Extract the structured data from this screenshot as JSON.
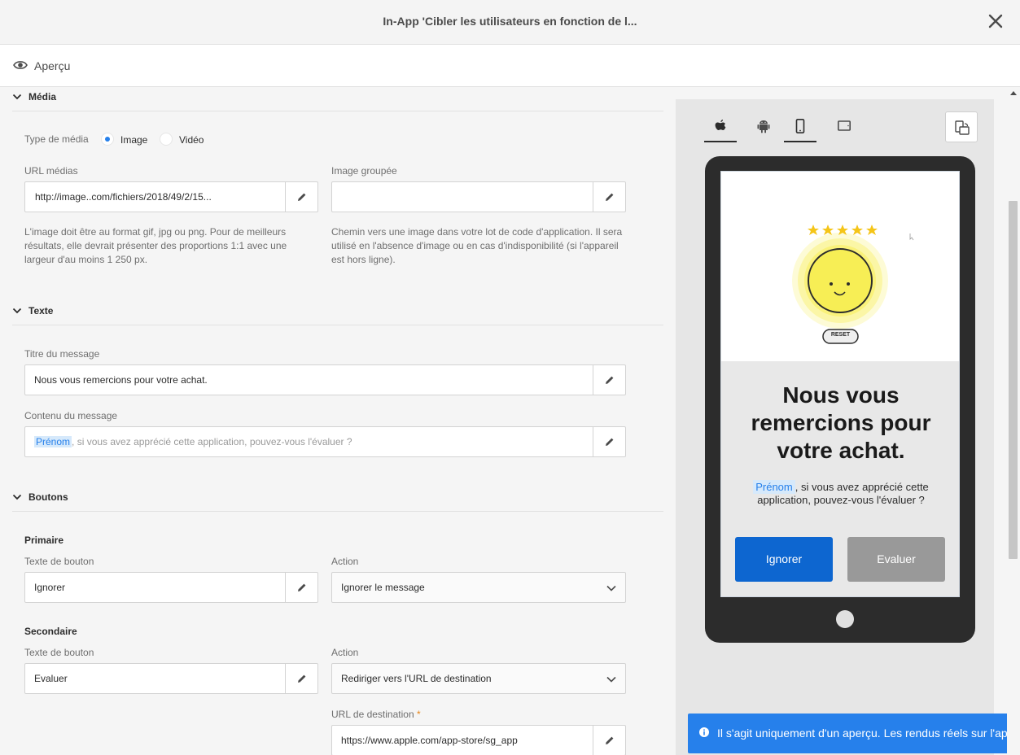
{
  "window": {
    "title": "In-App 'Cibler les utilisateurs en fonction de l...",
    "preview_label": "Aperçu"
  },
  "media": {
    "section_title": "Média",
    "type_label": "Type de média",
    "option_image": "Image",
    "option_video": "Vidéo",
    "selected": "Image",
    "url_label": "URL médias",
    "url_value": "http://image..com/fichiers/2018/49/2/15...",
    "url_help": "L'image doit être au format gif, jpg ou png. Pour de meilleurs résultats, elle devrait présenter des proportions 1:1 avec une largeur d'au moins 1 250 px.",
    "bundled_label": "Image groupée",
    "bundled_value": "",
    "bundled_help": "Chemin vers une image dans votre lot de code d'application. Il sera utilisé en l'absence d'image ou en cas d'indisponibilité (si l'appareil est hors ligne)."
  },
  "text": {
    "section_title": "Texte",
    "title_label": "Titre du message",
    "title_value": "Nous vous remercions pour votre achat.",
    "content_label": "Contenu du message",
    "content_token": "Prénom",
    "content_rest": ", si vous avez apprécié cette application, pouvez-vous l'évaluer ?"
  },
  "buttons": {
    "section_title": "Boutons",
    "primary": {
      "heading": "Primaire",
      "text_label": "Texte de bouton",
      "text_value": "Ignorer",
      "action_label": "Action",
      "action_value": "Ignorer le message"
    },
    "secondary": {
      "heading": "Secondaire",
      "text_label": "Texte de bouton",
      "text_value": "Evaluer",
      "action_label": "Action",
      "action_value": "Rediriger vers l'URL de destination",
      "dest_label": "URL de destination",
      "dest_required": "*",
      "dest_value": "https://www.apple.com/app-store/sg_app"
    }
  },
  "preview": {
    "os_tabs": [
      {
        "icon": "apple-icon",
        "active": true
      },
      {
        "icon": "android-icon",
        "active": false
      }
    ],
    "device_tabs": [
      {
        "icon": "phone-icon",
        "active": true
      },
      {
        "icon": "tablet-icon",
        "active": false
      }
    ],
    "hero_reset_label": "RESET",
    "message_title": "Nous vous remercions pour votre achat.",
    "message_token": "Prénom",
    "message_body": ", si vous avez apprécié cette application, pouvez-vous l'évaluer ?",
    "primary_button": "Ignorer",
    "secondary_button": "Evaluer",
    "notice": "Il s'agit uniquement d'un aperçu. Les rendus réels sur l'appare"
  },
  "colors": {
    "accent": "#2680eb",
    "primary_button": "#0d66d0",
    "secondary_button": "#999999",
    "star": "#f5c518",
    "smiley": "#f7ee55"
  }
}
